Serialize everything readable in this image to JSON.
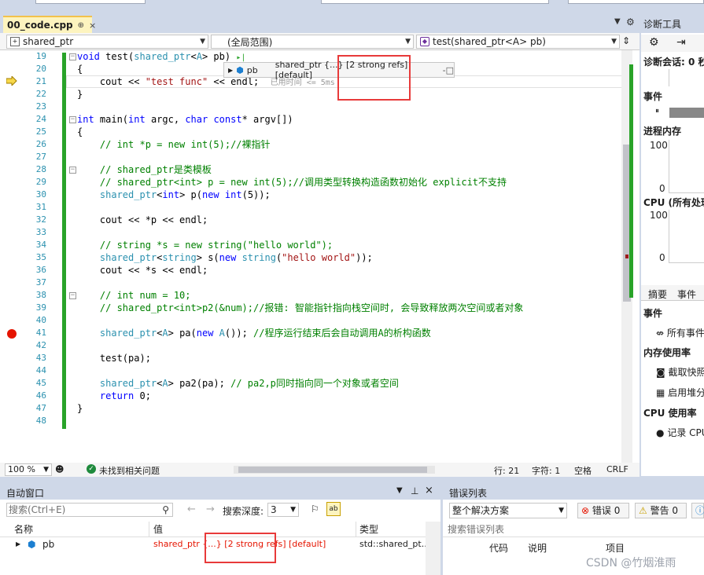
{
  "tab": {
    "filename": "00_code.cpp",
    "pin": "⊕",
    "close": "×"
  },
  "nav": {
    "scope1": "shared_ptr",
    "scope2": "(全局范围)",
    "scope3": "test(shared_ptr<A> pb)"
  },
  "editor": {
    "line_numbers": [
      "19",
      "20",
      "21",
      "22",
      "23",
      "24",
      "25",
      "26",
      "27",
      "28",
      "29",
      "30",
      "31",
      "32",
      "33",
      "34",
      "35",
      "36",
      "37",
      "38",
      "39",
      "40",
      "41",
      "42",
      "43",
      "44",
      "45",
      "46",
      "47",
      "48"
    ],
    "elapsed": "已用时间 <= 5ms"
  },
  "datatip": {
    "name": "pb",
    "value": "shared_ptr {...} [2 strong refs] [default]",
    "pin": "-□"
  },
  "status": {
    "zoom": "100 %",
    "issues": "未找到相关问题",
    "line": "行: 21",
    "char": "字符: 1",
    "spaces": "空格",
    "eol": "CRLF"
  },
  "diag": {
    "title": "诊断工具",
    "session": "诊断会话: 0 秒",
    "events": "事件",
    "process_memory": "进程内存",
    "mem_max": "100",
    "mem_min": "0",
    "cpu": "CPU (所有处理器)",
    "cpu_max": "100",
    "cpu_min": "0",
    "tab_summary": "摘要",
    "tab_events": "事件",
    "sec_events": "事件",
    "all_events": "所有事件",
    "sec_mem": "内存使用率",
    "snapshot": "截取快照",
    "sec_cpu": "CPU 使用率",
    "heap": "启用堆分析",
    "record_cpu": "记录 CPU 配置文件"
  },
  "auto": {
    "title": "自动窗口",
    "search_placeholder": "搜索(Ctrl+E)",
    "depth_label": "搜索深度:",
    "depth": "3",
    "col_name": "名称",
    "col_value": "值",
    "col_type": "类型",
    "row": {
      "name": "pb",
      "value": "shared_ptr {...} [2 strong refs] [default]",
      "type": "std::shared_pt..."
    }
  },
  "errors": {
    "title": "错误列表",
    "scope": "整个解决方案",
    "err": "错误 0",
    "warn": "警告 0",
    "search_placeholder": "搜索错误列表",
    "col_code": "代码",
    "col_desc": "说明",
    "col_item": "项目"
  },
  "watermark": "CSDN @竹烟淮雨"
}
